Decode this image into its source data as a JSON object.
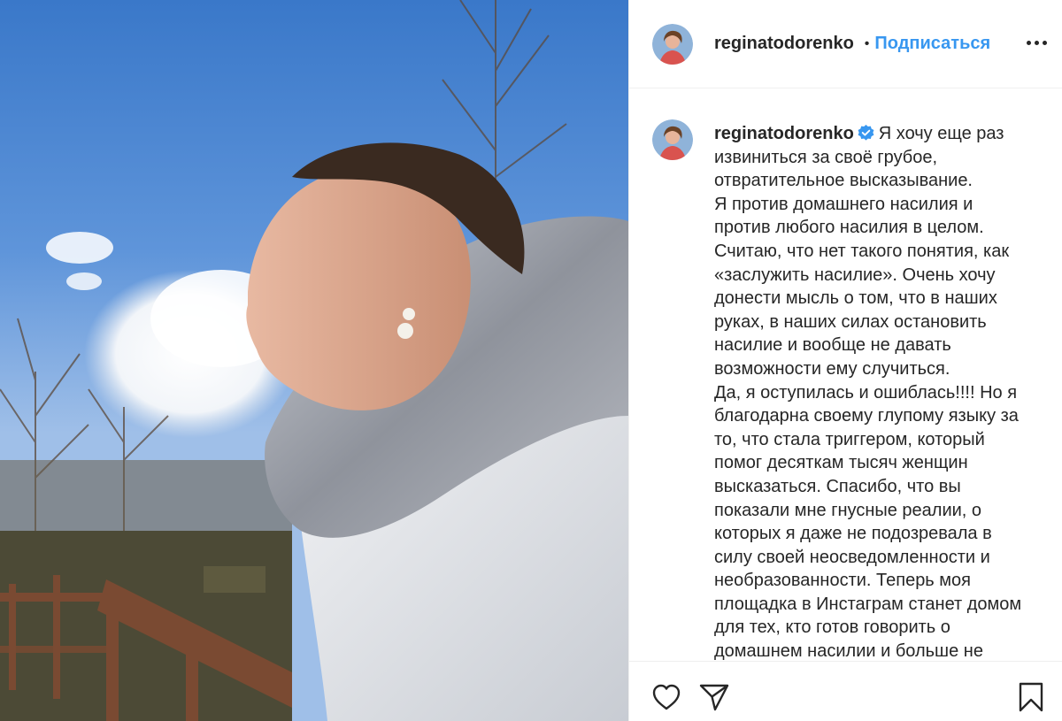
{
  "post": {
    "username": "reginatodorenko",
    "follow_label": "Подписаться",
    "separator": "•"
  },
  "caption": {
    "username": "reginatodorenko",
    "lines": [
      "Я хочу еще раз",
      "извиниться за своё грубое,",
      "отвратительное высказывание.",
      "Я против домашнего насилия и",
      "против любого насилия в целом.",
      "Считаю, что нет такого понятия, как",
      "«заслужить насилие». Очень хочу",
      "донести мысль о том, что в наших",
      "руках, в наших силах остановить",
      "насилие и вообще не давать",
      "возможности ему случиться.",
      "Да, я оступилась и ошиблась!!!! Но я",
      "благодарна своему глупому языку за",
      "то, что стала триггером, который",
      "помог десяткам тысяч женщин",
      "высказаться. Спасибо, что вы",
      "показали мне гнусные реалии, о",
      "которых я даже не подозревала в",
      "силу своей неосведомленности и",
      "необразованности. Теперь моя",
      "площадка в Инстаграм станет домом",
      "для тех, кто готов говорить о",
      "домашнем насилии и больше не"
    ]
  },
  "icons": {
    "more": "more-options-icon",
    "verified": "verified-badge-icon",
    "like": "heart-icon",
    "share": "paper-plane-icon",
    "save": "bookmark-icon"
  },
  "colors": {
    "accent": "#3897f0",
    "text": "#262626",
    "border": "#efefef",
    "verified": "#3897f0"
  }
}
